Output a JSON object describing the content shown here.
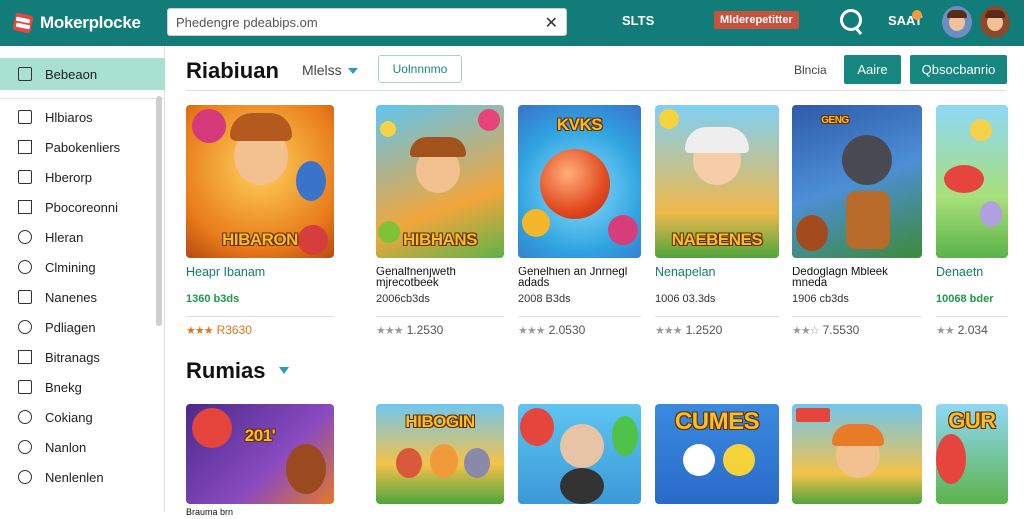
{
  "app": {
    "name": "Mokerplocke"
  },
  "search": {
    "placeholder": "Phedengre pdeabips.om",
    "clear_icon": "close-icon"
  },
  "topbar": {
    "link": "SLTS",
    "badge": "Mlderepetitter",
    "count": "SAAT"
  },
  "sidebar": {
    "active": "Bebeaon",
    "items": [
      {
        "label": "Hlbiaros",
        "icon": "document-icon"
      },
      {
        "label": "Pabokenliers",
        "icon": "square-icon"
      },
      {
        "label": "Hberorp",
        "icon": "image-icon"
      },
      {
        "label": "Pbocoreonni",
        "icon": "bookmark-icon"
      },
      {
        "label": "Hleran",
        "icon": "globe-icon"
      },
      {
        "label": "Clmining",
        "icon": "circle-icon"
      },
      {
        "label": "Nanenes",
        "icon": "tag-icon"
      },
      {
        "label": "Pdliagen",
        "icon": "settings-icon"
      },
      {
        "label": "Bitranags",
        "icon": "grid-icon"
      },
      {
        "label": "Bnekg",
        "icon": "edit-icon"
      },
      {
        "label": "Cokiang",
        "icon": "clock-icon"
      },
      {
        "label": "Nanlon",
        "icon": "circle-icon"
      },
      {
        "label": "Nenlenlen",
        "icon": "chat-icon"
      }
    ]
  },
  "main": {
    "section1": {
      "title": "Riabiuan",
      "filter": "Mlelss",
      "tag": "Uolnnnmo",
      "sort_label": "Blncia",
      "btn_primary": "Aaire",
      "btn_secondary": "Qbsocbanrio"
    },
    "section2": {
      "title": "Rumias"
    },
    "cards_row1": [
      {
        "thumb_text": "HIBARON",
        "name": "Heapr Ibanam",
        "meta": "1360 b3ds",
        "rating": "R3630",
        "name_style": "teal",
        "meta_style": "green",
        "stars_gold": true
      },
      {
        "thumb_text": "HIBHANS",
        "name": "Genalfnenjweth mjrecotbeek",
        "meta": "2006cb3ds",
        "rating": "1.2530",
        "name_style": "",
        "meta_style": "",
        "stars_gold": false
      },
      {
        "thumb_text": "KVKS",
        "name": "Genelhien an Jnrnegl adads",
        "meta": "2008 B3ds",
        "rating": "2.0530",
        "name_style": "",
        "meta_style": "",
        "stars_gold": false
      },
      {
        "thumb_text": "NAEBENES",
        "name": "Nenapelan",
        "meta": "1006 03.3ds",
        "rating": "1.2520",
        "name_style": "teal",
        "meta_style": "",
        "stars_gold": false
      },
      {
        "thumb_text": "GENG",
        "name": "Dedoglagn Mbleek mneda",
        "meta": "1906 cb3ds",
        "rating": "7.5530",
        "name_style": "",
        "meta_style": "",
        "stars_gold": false
      },
      {
        "thumb_text": "",
        "name": "Denaetn",
        "meta": "10068 bder",
        "rating": "2.034",
        "name_style": "teal",
        "meta_style": "green",
        "stars_gold": false
      }
    ],
    "cards_row2": [
      {
        "thumb_text": "201'"
      },
      {
        "thumb_text": "HIBOGIN"
      },
      {
        "thumb_text": ""
      },
      {
        "thumb_text": "CUMES"
      },
      {
        "thumb_text": ""
      },
      {
        "thumb_text": "GUR"
      }
    ],
    "row2_partial_caption": "Brauma brn"
  },
  "colors": {
    "topbar": "#117c78",
    "accent": "#16877f",
    "active_nav": "#a8e0d1",
    "badge": "#c7523d"
  }
}
